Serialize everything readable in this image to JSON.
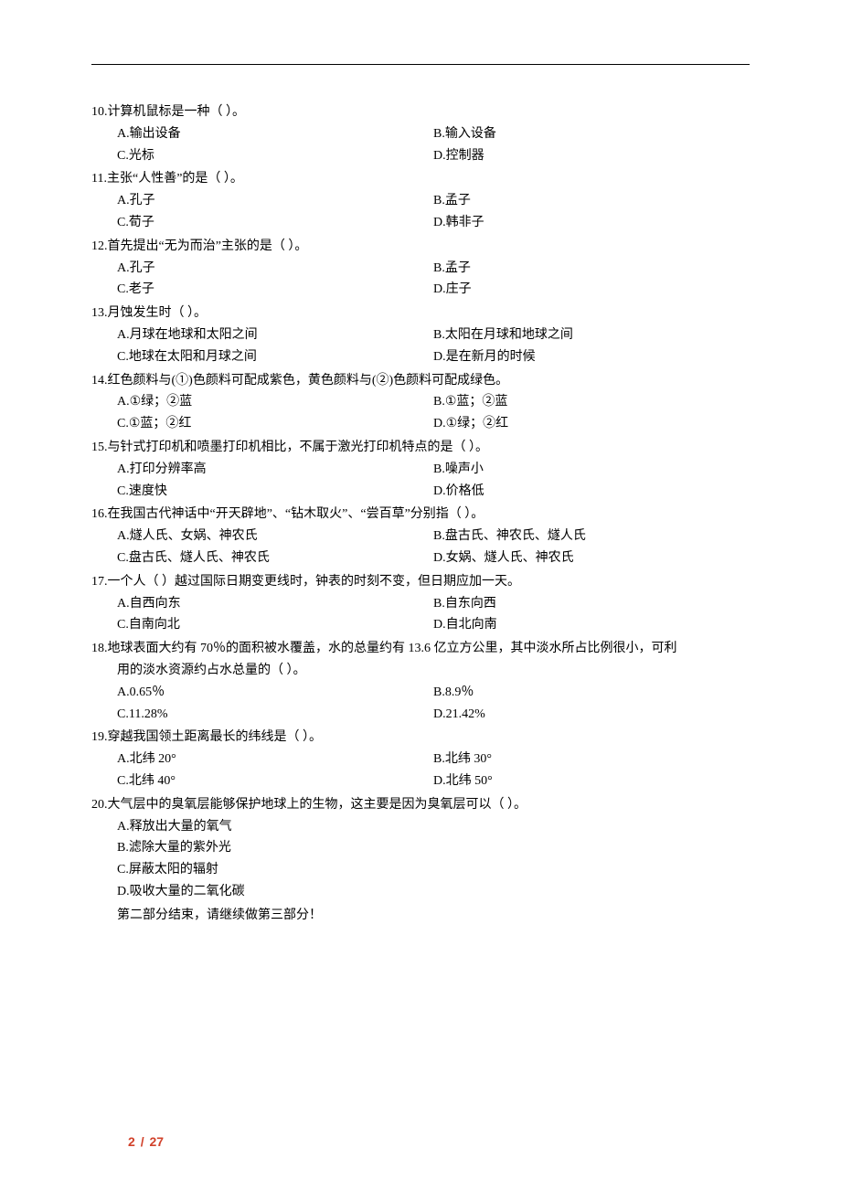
{
  "page": {
    "current": "2",
    "total": "27"
  },
  "sectionEnd": "第二部分结束，请继续做第三部分！",
  "questions": [
    {
      "num": "10",
      "stem": "10.计算机鼠标是一种（    ）。",
      "layout": "2col",
      "opts": [
        "A.输出设备",
        "B.输入设备",
        "C.光标",
        "D.控制器"
      ]
    },
    {
      "num": "11",
      "stem": "11.主张“人性善”的是（    ）。",
      "layout": "2col",
      "opts": [
        "A.孔子",
        "B.孟子",
        "C.荀子",
        "D.韩非子"
      ]
    },
    {
      "num": "12",
      "stem": "12.首先提出“无为而治”主张的是（    ）。",
      "layout": "2col",
      "opts": [
        "A.孔子",
        "B.孟子",
        "C.老子",
        "D.庄子"
      ]
    },
    {
      "num": "13",
      "stem": "13.月蚀发生时（    ）。",
      "layout": "2col",
      "opts": [
        "A.月球在地球和太阳之间",
        "B.太阳在月球和地球之间",
        "C.地球在太阳和月球之间",
        "D.是在新月的时候"
      ]
    },
    {
      "num": "14",
      "stem": "14.红色颜料与(①)色颜料可配成紫色，黄色颜料与(②)色颜料可配成绿色。",
      "layout": "2col",
      "opts": [
        "A.①绿；②蓝",
        "B.①蓝；②蓝",
        "C.①蓝；②红",
        "D.①绿；②红"
      ]
    },
    {
      "num": "15",
      "stem": "15.与针式打印机和喷墨打印机相比，不属于激光打印机特点的是（    ）。",
      "layout": "2col",
      "opts": [
        "A.打印分辨率高",
        "B.噪声小",
        "C.速度快",
        "D.价格低"
      ]
    },
    {
      "num": "16",
      "stem": "16.在我国古代神话中“开天辟地”、“钻木取火”、“尝百草”分别指（    ）。",
      "layout": "2col",
      "opts": [
        "A.燧人氏、女娲、神农氏",
        "B.盘古氏、神农氏、燧人氏",
        "C.盘古氏、燧人氏、神农氏",
        "D.女娲、燧人氏、神农氏"
      ]
    },
    {
      "num": "17",
      "stem": "17.一个人（    ）越过国际日期变更线时，钟表的时刻不变，但日期应加一天。",
      "layout": "2col",
      "opts": [
        "A.自西向东",
        "B.自东向西",
        "C.自南向北",
        "D.自北向南"
      ]
    },
    {
      "num": "18",
      "stem": "18.地球表面大约有 70％的面积被水覆盖，水的总量约有 13.6 亿立方公里，其中淡水所占比例很小，可利",
      "cont": "用的淡水资源约占水总量的（    ）。",
      "layout": "2col",
      "opts": [
        "A.0.65％",
        "B.8.9％",
        "C.11.28%",
        "D.21.42%"
      ]
    },
    {
      "num": "19",
      "stem": "19.穿越我国领土距离最长的纬线是（    ）。",
      "layout": "2col",
      "opts": [
        "A.北纬 20°",
        "B.北纬 30°",
        "C.北纬 40°",
        "D.北纬 50°"
      ]
    },
    {
      "num": "20",
      "stem": "20.大气层中的臭氧层能够保护地球上的生物，这主要是因为臭氧层可以（    ）。",
      "layout": "1col",
      "opts": [
        "A.释放出大量的氧气",
        "B.滤除大量的紫外光",
        "C.屏蔽太阳的辐射",
        "D.吸收大量的二氧化碳"
      ]
    }
  ]
}
